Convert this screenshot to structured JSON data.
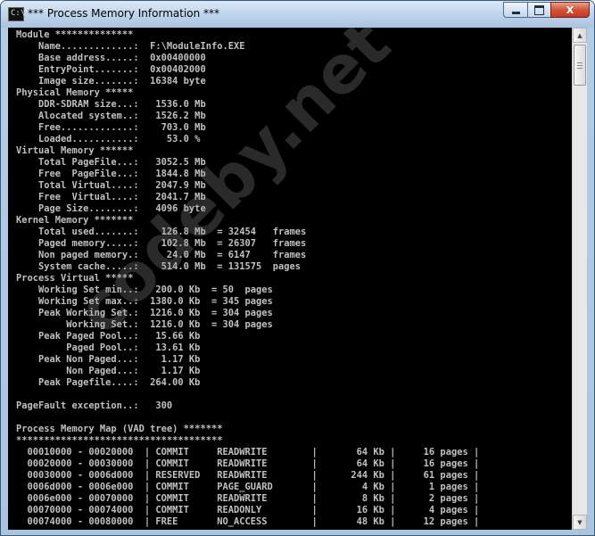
{
  "window": {
    "title": "*** Process Memory Information ***",
    "app_icon_text": "C:\\",
    "close_label": "X"
  },
  "watermark": "codeby.net",
  "console_lines": [
    "Module **************",
    "    Name.............:  F:\\ModuleInfo.EXE",
    "    Base address.....:  0x00400000",
    "    EntryPoint.......:  0x00402000",
    "    Image size.......:  16384 byte",
    "Physical Memory *****",
    "    DDR-SDRAM size...:   1536.0 Mb",
    "    Alocated system..:   1526.2 Mb",
    "    Free.............:    703.0 Mb",
    "    Loaded...........:     53.0 %",
    "Virtual Memory ******",
    "    Total PageFile...:   3052.5 Mb",
    "    Free  PageFile...:   1844.8 Mb",
    "    Total Virtual....:   2047.9 Mb",
    "    Free  Virtual....:   2041.7 Mb",
    "    Page Size........:   4096 byte",
    "Kernel Memory *******",
    "    Total used.......:    126.8 Mb  = 32454   frames",
    "    Paged memory.....:    102.8 Mb  = 26307   frames",
    "    Non paged memory.:     24.0 Mb  = 6147    frames",
    "    System cache.....:    514.0 Mb  = 131575  pages",
    "Process Virtual *****",
    "    Working Set min..:   200.0 Kb  = 50  pages",
    "    Working Set max..:  1380.0 Kb  = 345 pages",
    "    Peak Working Set.:  1216.0 Kb  = 304 pages",
    "         Working Set.:  1216.0 Kb  = 304 pages",
    "    Peak Paged Pool..:   15.66 Kb",
    "         Paged Pool..:   13.61 Kb",
    "    Peak Non Paged...:    1.17 Kb",
    "         Non Paged...:    1.17 Kb",
    "    Peak Pagefile....:  264.00 Kb",
    "",
    "PageFault exception..:   300",
    "",
    "Process Memory Map (VAD tree) *******",
    "*************************************",
    "  00010000 - 00020000  | COMMIT     READWRITE        |       64 Kb |     16 pages |",
    "  00020000 - 00030000  | COMMIT     READWRITE        |       64 Kb |     16 pages |",
    "  00030000 - 0006d000  | RESERVED   READWRITE        |      244 Kb |     61 pages |",
    "  0006d000 - 0006e000  | COMMIT     PAGE_GUARD       |        4 Kb |      1 pages |",
    "  0006e000 - 00070000  | COMMIT     READWRITE        |        8 Kb |      2 pages |",
    "  00070000 - 00074000  | COMMIT     READONLY         |       16 Kb |      4 pages |",
    "  00074000 - 00080000  | FREE       NO_ACCESS        |       48 Kb |     12 pages |"
  ]
}
